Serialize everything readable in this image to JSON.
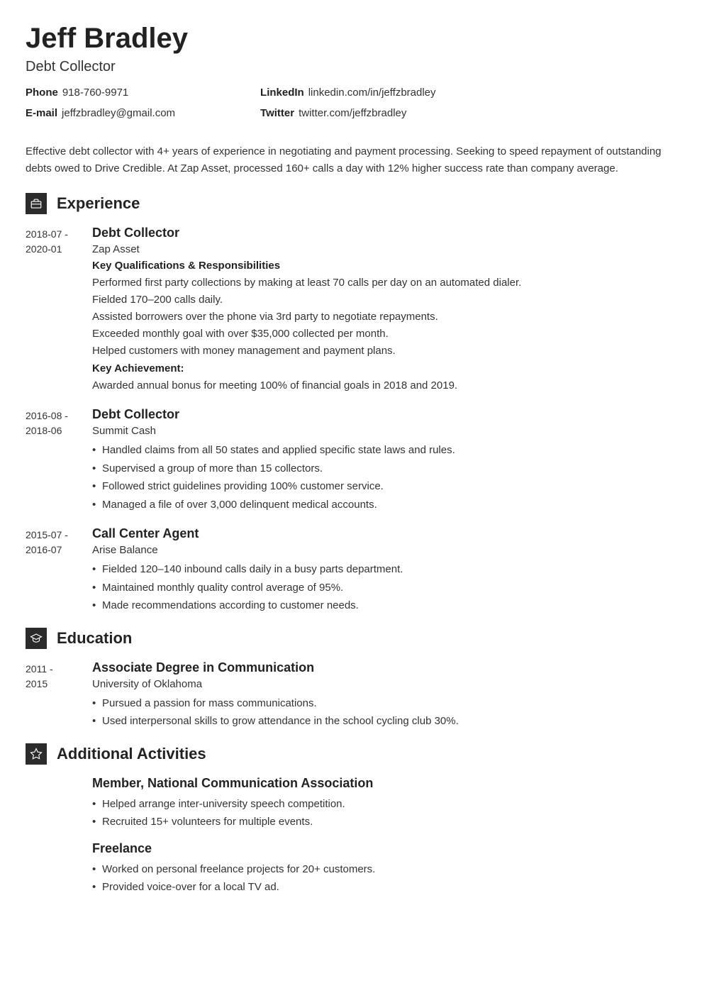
{
  "name": "Jeff Bradley",
  "title": "Debt Collector",
  "contact": {
    "phone_label": "Phone",
    "phone": "918-760-9971",
    "email_label": "E-mail",
    "email": "jeffzbradley@gmail.com",
    "linkedin_label": "LinkedIn",
    "linkedin": "linkedin.com/in/jeffzbradley",
    "twitter_label": "Twitter",
    "twitter": "twitter.com/jeffzbradley"
  },
  "summary": "Effective debt collector with 4+ years of experience in negotiating and payment processing. Seeking to speed repayment of outstanding debts owed to Drive Credible. At Zap Asset, processed 160+ calls a day with 12% higher success rate than company average.",
  "sections": {
    "experience_title": "Experience",
    "education_title": "Education",
    "activities_title": "Additional Activities"
  },
  "experience": [
    {
      "start": "2018-07 -",
      "end": "2020-01",
      "title": "Debt Collector",
      "org": "Zap Asset",
      "qual_header": "Key Qualifications & Responsibilities",
      "lines": [
        "Performed first party collections by making at least 70 calls per day on an automated dialer.",
        "Fielded 170–200 calls daily.",
        "Assisted borrowers over the phone via 3rd party to negotiate repayments.",
        "Exceeded monthly goal with over $35,000 collected per month.",
        "Helped customers with money management and payment plans."
      ],
      "ach_header": "Key Achievement:",
      "achievement": "Awarded annual bonus for meeting 100% of financial goals in 2018 and 2019."
    },
    {
      "start": "2016-08 -",
      "end": "2018-06",
      "title": "Debt Collector",
      "org": "Summit Cash",
      "bullets": [
        "Handled claims from all 50 states and applied specific state laws and rules.",
        "Supervised a group of more than 15 collectors.",
        "Followed strict guidelines providing 100% customer service.",
        "Managed a file of over 3,000 delinquent medical accounts."
      ]
    },
    {
      "start": "2015-07 -",
      "end": "2016-07",
      "title": "Call Center Agent",
      "org": "Arise Balance",
      "bullets": [
        "Fielded 120–140 inbound calls daily in a busy parts department.",
        "Maintained monthly quality control average of 95%.",
        "Made recommendations according to customer needs."
      ]
    }
  ],
  "education": [
    {
      "start": "2011 -",
      "end": "2015",
      "title": "Associate Degree in Communication",
      "org": "University of Oklahoma",
      "bullets": [
        "Pursued a passion for mass communications.",
        "Used interpersonal skills to grow attendance in the school cycling club 30%."
      ]
    }
  ],
  "activities": [
    {
      "title": "Member, National Communication Association",
      "bullets": [
        "Helped arrange inter-university speech competition.",
        "Recruited 15+ volunteers for multiple events."
      ]
    },
    {
      "title": "Freelance",
      "bullets": [
        "Worked on personal freelance projects for 20+ customers.",
        "Provided voice-over for a local TV ad."
      ]
    }
  ]
}
